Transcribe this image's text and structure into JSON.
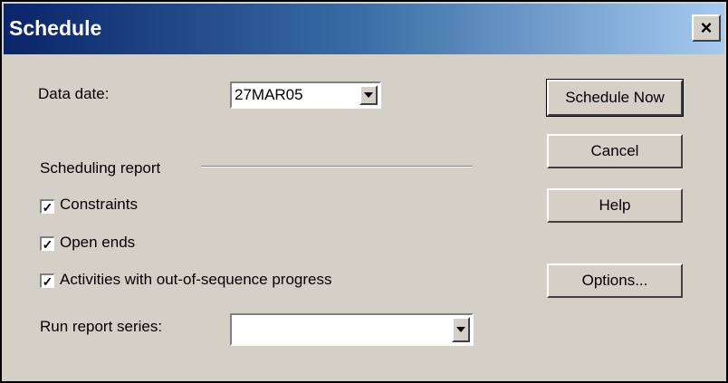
{
  "window": {
    "title": "Schedule",
    "close_label": "×"
  },
  "data_date": {
    "label": "Data date:",
    "value": "27MAR05"
  },
  "scheduling_report": {
    "group_label": "Scheduling report",
    "options": [
      {
        "label": "Constraints",
        "checked": true
      },
      {
        "label": "Open ends",
        "checked": true
      },
      {
        "label": "Activities with out-of-sequence progress",
        "checked": true
      }
    ],
    "run_report_label": "Run report series:",
    "run_report_value": ""
  },
  "buttons": {
    "schedule_now": "Schedule Now",
    "cancel": "Cancel",
    "help": "Help",
    "options": "Options..."
  },
  "check_glyph": "✓"
}
